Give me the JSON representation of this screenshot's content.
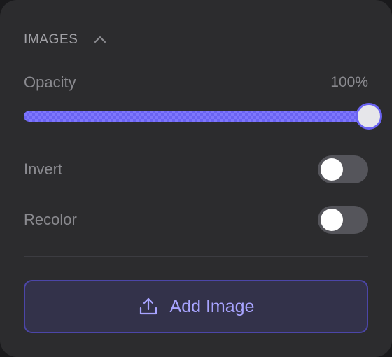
{
  "section": {
    "title": "IMAGES",
    "chevron_icon": "chevron-up-icon"
  },
  "opacity": {
    "label": "Opacity",
    "value_text": "100%",
    "value_fraction": 1.0
  },
  "invert": {
    "label": "Invert",
    "enabled": false
  },
  "recolor": {
    "label": "Recolor",
    "enabled": false
  },
  "add_image": {
    "label": "Add Image",
    "icon": "upload-icon"
  },
  "colors": {
    "panel_bg": "#2c2c2e",
    "accent": "#6a63f2",
    "accent_text": "#a8a4ff",
    "toggle_off": "#55555b",
    "muted_text": "#8a8a8f"
  }
}
